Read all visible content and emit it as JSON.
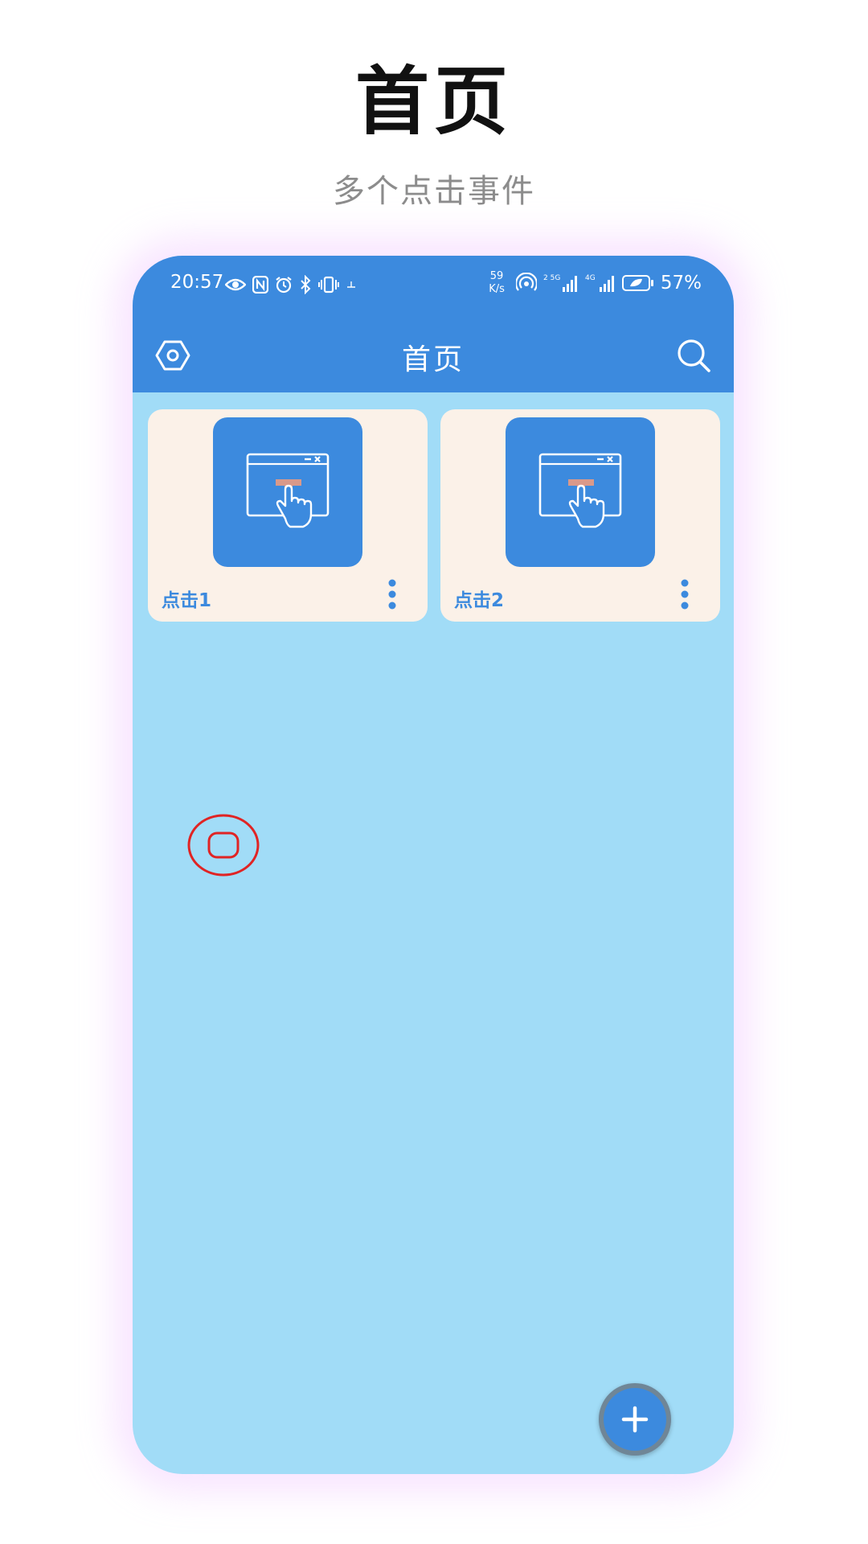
{
  "promo": {
    "title": "首页",
    "subtitle": "多个点击事件"
  },
  "status_bar": {
    "time": "20:57",
    "net_speed_value": "59",
    "net_speed_unit": "K/s",
    "network_1": "5G",
    "network_2": "4G",
    "battery_percent": "57%"
  },
  "app_bar": {
    "title": "首页",
    "left_icon": "settings-hexagon-icon",
    "right_icon": "search-icon"
  },
  "cards": [
    {
      "label": "点击1",
      "icon": "click-window-icon"
    },
    {
      "label": "点击2",
      "icon": "click-window-icon"
    }
  ],
  "floating_control": {
    "icon": "floating-ball-icon"
  },
  "fab": {
    "icon": "plus-icon"
  },
  "colors": {
    "primary": "#3c8ade",
    "background": "#a1dcf7",
    "card": "#fbf1e8",
    "accent_finger": "#d9998a",
    "float_ring": "#e02424"
  }
}
